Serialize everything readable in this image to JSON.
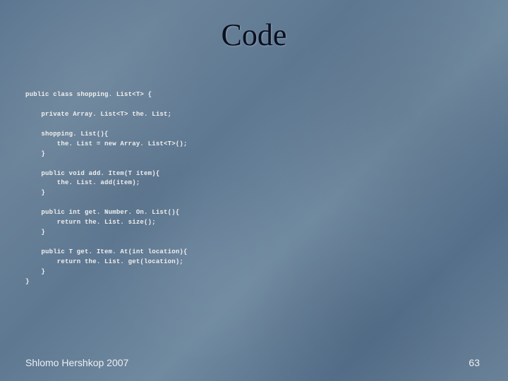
{
  "slide": {
    "title": "Code",
    "code": "public class shopping. List<T> {\n\n    private Array. List<T> the. List;\n\n    shopping. List(){\n        the. List = new Array. List<T>();\n    }\n\n    public void add. Item(T item){\n        the. List. add(item);\n    }\n\n    public int get. Number. On. List(){\n        return the. List. size();\n    }\n\n    public T get. Item. At(int location){\n        return the. List. get(location);\n    }\n}",
    "footer_author": "Shlomo Hershkop 2007",
    "page_number": "63"
  }
}
